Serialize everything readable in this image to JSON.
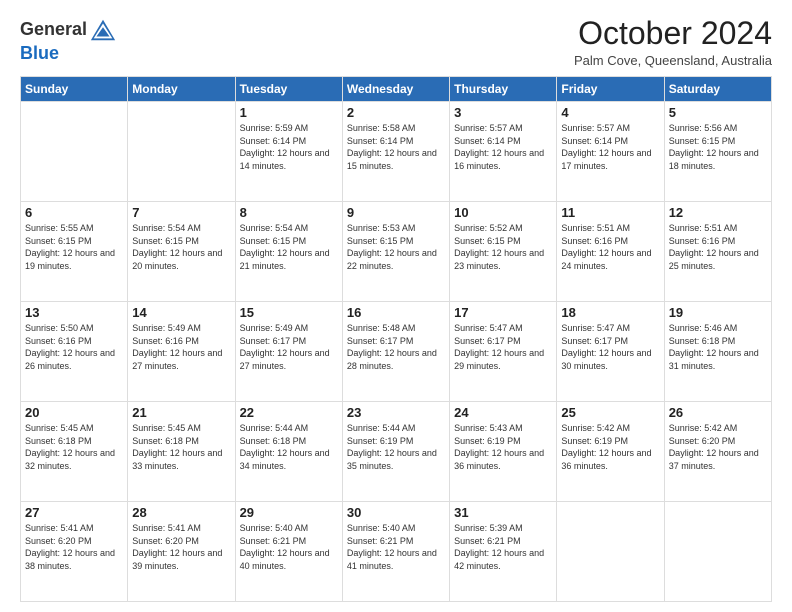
{
  "logo": {
    "line1": "General",
    "line2": "Blue"
  },
  "header": {
    "month": "October 2024",
    "location": "Palm Cove, Queensland, Australia"
  },
  "days_of_week": [
    "Sunday",
    "Monday",
    "Tuesday",
    "Wednesday",
    "Thursday",
    "Friday",
    "Saturday"
  ],
  "weeks": [
    [
      {
        "day": "",
        "info": ""
      },
      {
        "day": "",
        "info": ""
      },
      {
        "day": "1",
        "info": "Sunrise: 5:59 AM\nSunset: 6:14 PM\nDaylight: 12 hours and 14 minutes."
      },
      {
        "day": "2",
        "info": "Sunrise: 5:58 AM\nSunset: 6:14 PM\nDaylight: 12 hours and 15 minutes."
      },
      {
        "day": "3",
        "info": "Sunrise: 5:57 AM\nSunset: 6:14 PM\nDaylight: 12 hours and 16 minutes."
      },
      {
        "day": "4",
        "info": "Sunrise: 5:57 AM\nSunset: 6:14 PM\nDaylight: 12 hours and 17 minutes."
      },
      {
        "day": "5",
        "info": "Sunrise: 5:56 AM\nSunset: 6:15 PM\nDaylight: 12 hours and 18 minutes."
      }
    ],
    [
      {
        "day": "6",
        "info": "Sunrise: 5:55 AM\nSunset: 6:15 PM\nDaylight: 12 hours and 19 minutes."
      },
      {
        "day": "7",
        "info": "Sunrise: 5:54 AM\nSunset: 6:15 PM\nDaylight: 12 hours and 20 minutes."
      },
      {
        "day": "8",
        "info": "Sunrise: 5:54 AM\nSunset: 6:15 PM\nDaylight: 12 hours and 21 minutes."
      },
      {
        "day": "9",
        "info": "Sunrise: 5:53 AM\nSunset: 6:15 PM\nDaylight: 12 hours and 22 minutes."
      },
      {
        "day": "10",
        "info": "Sunrise: 5:52 AM\nSunset: 6:15 PM\nDaylight: 12 hours and 23 minutes."
      },
      {
        "day": "11",
        "info": "Sunrise: 5:51 AM\nSunset: 6:16 PM\nDaylight: 12 hours and 24 minutes."
      },
      {
        "day": "12",
        "info": "Sunrise: 5:51 AM\nSunset: 6:16 PM\nDaylight: 12 hours and 25 minutes."
      }
    ],
    [
      {
        "day": "13",
        "info": "Sunrise: 5:50 AM\nSunset: 6:16 PM\nDaylight: 12 hours and 26 minutes."
      },
      {
        "day": "14",
        "info": "Sunrise: 5:49 AM\nSunset: 6:16 PM\nDaylight: 12 hours and 27 minutes."
      },
      {
        "day": "15",
        "info": "Sunrise: 5:49 AM\nSunset: 6:17 PM\nDaylight: 12 hours and 27 minutes."
      },
      {
        "day": "16",
        "info": "Sunrise: 5:48 AM\nSunset: 6:17 PM\nDaylight: 12 hours and 28 minutes."
      },
      {
        "day": "17",
        "info": "Sunrise: 5:47 AM\nSunset: 6:17 PM\nDaylight: 12 hours and 29 minutes."
      },
      {
        "day": "18",
        "info": "Sunrise: 5:47 AM\nSunset: 6:17 PM\nDaylight: 12 hours and 30 minutes."
      },
      {
        "day": "19",
        "info": "Sunrise: 5:46 AM\nSunset: 6:18 PM\nDaylight: 12 hours and 31 minutes."
      }
    ],
    [
      {
        "day": "20",
        "info": "Sunrise: 5:45 AM\nSunset: 6:18 PM\nDaylight: 12 hours and 32 minutes."
      },
      {
        "day": "21",
        "info": "Sunrise: 5:45 AM\nSunset: 6:18 PM\nDaylight: 12 hours and 33 minutes."
      },
      {
        "day": "22",
        "info": "Sunrise: 5:44 AM\nSunset: 6:18 PM\nDaylight: 12 hours and 34 minutes."
      },
      {
        "day": "23",
        "info": "Sunrise: 5:44 AM\nSunset: 6:19 PM\nDaylight: 12 hours and 35 minutes."
      },
      {
        "day": "24",
        "info": "Sunrise: 5:43 AM\nSunset: 6:19 PM\nDaylight: 12 hours and 36 minutes."
      },
      {
        "day": "25",
        "info": "Sunrise: 5:42 AM\nSunset: 6:19 PM\nDaylight: 12 hours and 36 minutes."
      },
      {
        "day": "26",
        "info": "Sunrise: 5:42 AM\nSunset: 6:20 PM\nDaylight: 12 hours and 37 minutes."
      }
    ],
    [
      {
        "day": "27",
        "info": "Sunrise: 5:41 AM\nSunset: 6:20 PM\nDaylight: 12 hours and 38 minutes."
      },
      {
        "day": "28",
        "info": "Sunrise: 5:41 AM\nSunset: 6:20 PM\nDaylight: 12 hours and 39 minutes."
      },
      {
        "day": "29",
        "info": "Sunrise: 5:40 AM\nSunset: 6:21 PM\nDaylight: 12 hours and 40 minutes."
      },
      {
        "day": "30",
        "info": "Sunrise: 5:40 AM\nSunset: 6:21 PM\nDaylight: 12 hours and 41 minutes."
      },
      {
        "day": "31",
        "info": "Sunrise: 5:39 AM\nSunset: 6:21 PM\nDaylight: 12 hours and 42 minutes."
      },
      {
        "day": "",
        "info": ""
      },
      {
        "day": "",
        "info": ""
      }
    ]
  ]
}
